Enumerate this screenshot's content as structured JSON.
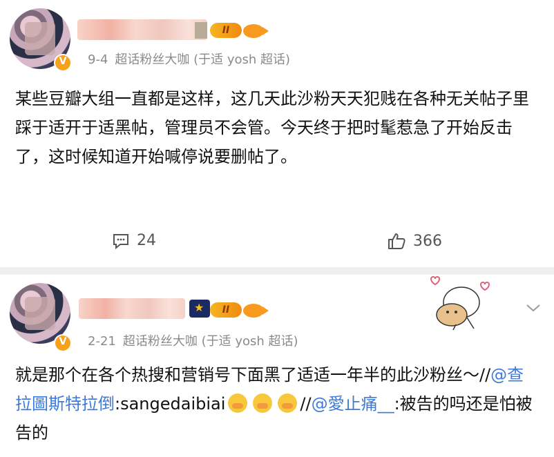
{
  "posts": [
    {
      "date": "9-4",
      "source": "超话粉丝大咖 (于适 yosh 超话)",
      "level_badge": "II",
      "text": "某些豆瓣大组一直都是这样，这几天此沙粉天天犯贱在各种无关帖子里踩于适开于适黑帖，管理员不会管。今天终于把时髦惹急了开始反击了，这时候知道开始喊停说要删帖了。",
      "comments": "24",
      "likes": "366"
    },
    {
      "date": "2-21",
      "source": "超话粉丝大咖 (于适 yosh 超话)",
      "level_badge": "II",
      "text_prefix": "就是那个在各个热搜和营销号下面黑了适适一年半的此沙粉丝～//",
      "mention1": "@查拉圖斯特拉倒",
      "text_mid": ":sangedaibiai",
      "text_mid2": "//",
      "mention2": "@愛止痛__",
      "text_suffix": ":被告的吗还是怕被告的"
    }
  ],
  "icons": {
    "comment": "comment-icon",
    "like": "thumbs-up-icon",
    "more": "chevron-down-icon",
    "verified": "verified-v-icon",
    "fish": "fish-badge-icon",
    "crown": "crown-badge-icon"
  },
  "colors": {
    "link": "#3f7bd6",
    "badge_orange": "#f79a1e",
    "meta_gray": "#8a8a8a"
  }
}
